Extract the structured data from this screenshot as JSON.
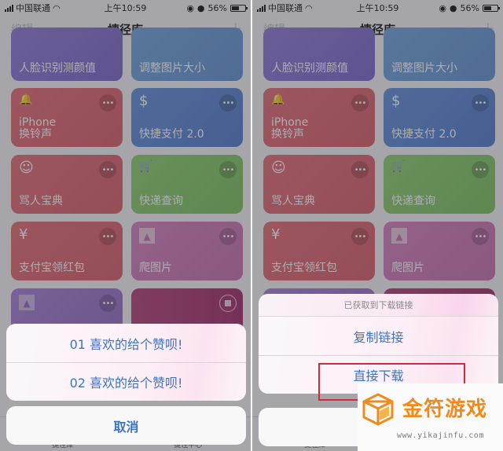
{
  "status_bar": {
    "carrier": "中国联通",
    "time": "上午10:59",
    "battery": "56%",
    "battery_level": 0.56
  },
  "nav": {
    "left": "编辑",
    "title": "捷径库",
    "right": "+"
  },
  "cards": [
    {
      "label": "人脸识别测颜值",
      "icon": "",
      "color": "purple"
    },
    {
      "label": "调整图片大小",
      "icon": "",
      "color": "lightblue"
    },
    {
      "label": "iPhone\n换铃声",
      "icon": "bell-icon",
      "color": "red"
    },
    {
      "label": "快捷支付 2.0",
      "icon": "dollar-icon",
      "color": "blue"
    },
    {
      "label": "骂人宝典",
      "icon": "smiley-icon",
      "color": "red"
    },
    {
      "label": "快递查询",
      "icon": "cart-icon",
      "color": "green"
    },
    {
      "label": "支付宝领红包",
      "icon": "yen-icon",
      "color": "red"
    },
    {
      "label": "爬图片",
      "icon": "image-icon",
      "color": "pink"
    },
    {
      "label": "",
      "icon": "image-icon",
      "color": "violet"
    },
    {
      "label": "",
      "icon": "stop-icon",
      "color": "magenta"
    }
  ],
  "glyphs": {
    "bell": "🔔",
    "dollar": "$",
    "smiley": "☺",
    "cart": "🛒",
    "yen": "¥",
    "image": "▲",
    "more": "•••",
    "wifi": "◠",
    "lock": "◉",
    "alarm": "●"
  },
  "tab_bar": {
    "tabs": [
      "捷径库",
      "捷径中心"
    ]
  },
  "left_sheet": {
    "options": [
      "01 喜欢的给个赞呗!",
      "02 喜欢的给个赞呗!"
    ],
    "cancel": "取消"
  },
  "right_sheet": {
    "header": "已获取到下载链接",
    "options": [
      "复制链接",
      "直接下载"
    ],
    "highlighted": "直接下载"
  },
  "watermark": {
    "title": "金符游戏",
    "url": "www.yikajinfu.com",
    "color": "#f08a1c"
  },
  "colors": {
    "accent": "#3c74c2",
    "highlight_border": "#d3293b"
  }
}
